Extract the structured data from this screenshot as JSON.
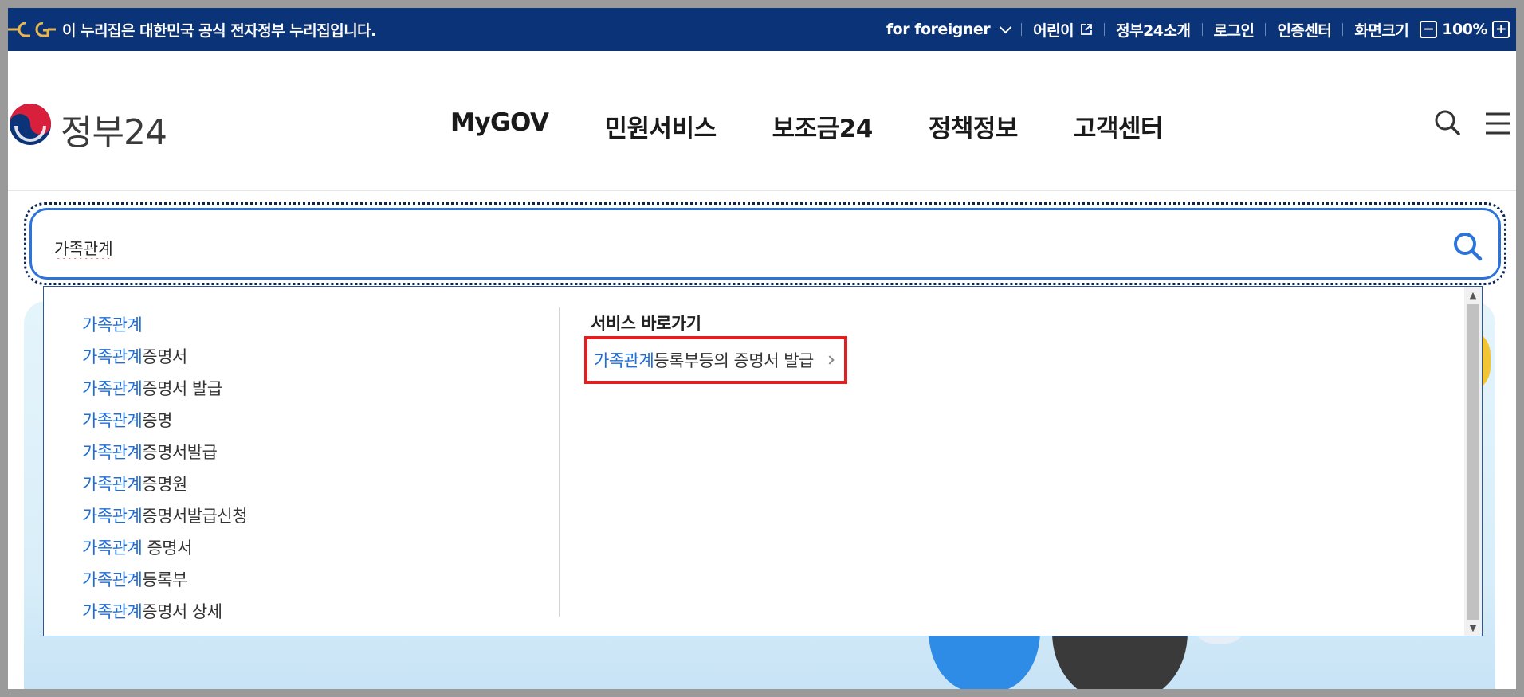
{
  "govbar": {
    "notice": "이 누리집은 대한민국 공식 전자정부 누리집입니다.",
    "foreigner": "for foreigner",
    "children": "어린이",
    "about": "정부24소개",
    "login": "로그인",
    "cert": "인증센터",
    "screen_size": "화면크기",
    "zoom_minus": "−",
    "zoom_value": "100%",
    "zoom_plus": "+"
  },
  "header": {
    "logo_text": "정부24",
    "nav": [
      "MyGOV",
      "민원서비스",
      "보조금24",
      "정책정보",
      "고객센터"
    ]
  },
  "search": {
    "value": "가족관계"
  },
  "autocomplete": {
    "suggestions": [
      {
        "hl": "가족관계",
        "rest": ""
      },
      {
        "hl": "가족관계",
        "rest": "증명서"
      },
      {
        "hl": "가족관계",
        "rest": "증명서 발급"
      },
      {
        "hl": "가족관계",
        "rest": "증명"
      },
      {
        "hl": "가족관계",
        "rest": "증명서발급"
      },
      {
        "hl": "가족관계",
        "rest": "증명원"
      },
      {
        "hl": "가족관계",
        "rest": "증명서발급신청"
      },
      {
        "hl": "가족관계",
        "rest": " 증명서"
      },
      {
        "hl": "가족관계",
        "rest": "등록부"
      },
      {
        "hl": "가족관계",
        "rest": "증명서 상세"
      }
    ],
    "services_title": "서비스 바로가기",
    "service_link": {
      "hl": "가족관계",
      "rest": "등록부등의 증명서 발급"
    },
    "scroll_up": "▲",
    "scroll_down": "▼"
  },
  "colors": {
    "govbar_bg": "#0b3478",
    "highlight": "#1f6ed6",
    "search_border": "#2b74d8",
    "focus_box": "#e02020"
  }
}
